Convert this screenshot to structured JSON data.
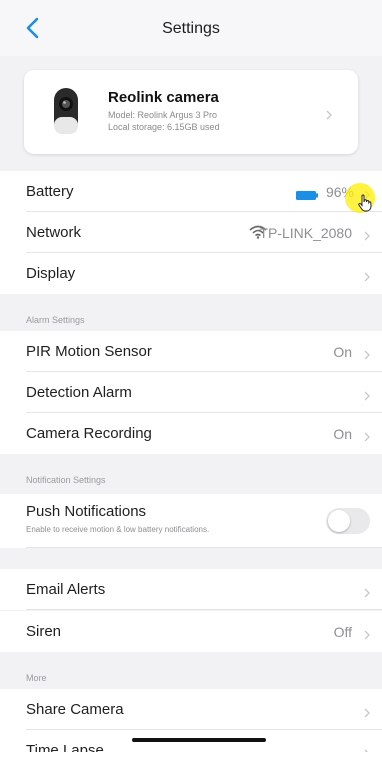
{
  "header": {
    "title": "Settings"
  },
  "camera": {
    "name": "Reolink camera",
    "model": "Model: Reolink Argus 3 Pro",
    "storage": "Local storage: 6.15GB used"
  },
  "rows_main": {
    "battery": {
      "label": "Battery",
      "value": "96%",
      "level": 0.96
    },
    "network": {
      "label": "Network",
      "value": "TP-LINK_2080"
    },
    "display": {
      "label": "Display"
    }
  },
  "alarm": {
    "section": "Alarm Settings",
    "pir": {
      "label": "PIR Motion Sensor",
      "value": "On"
    },
    "detection": {
      "label": "Detection Alarm"
    },
    "recording": {
      "label": "Camera Recording",
      "value": "On"
    }
  },
  "notification": {
    "section": "Notification Settings",
    "push": {
      "label": "Push Notifications",
      "desc": "Enable to receive motion & low battery notifications.",
      "enabled": false
    },
    "email": {
      "label": "Email Alerts"
    },
    "siren": {
      "label": "Siren",
      "value": "Off"
    }
  },
  "more": {
    "section": "More",
    "share": {
      "label": "Share Camera"
    },
    "timelapse": {
      "label": "Time Lapse"
    }
  },
  "colors": {
    "accent": "#1a8fe3",
    "chevron": "#c7c7cc",
    "background": "#f2f2f4"
  }
}
